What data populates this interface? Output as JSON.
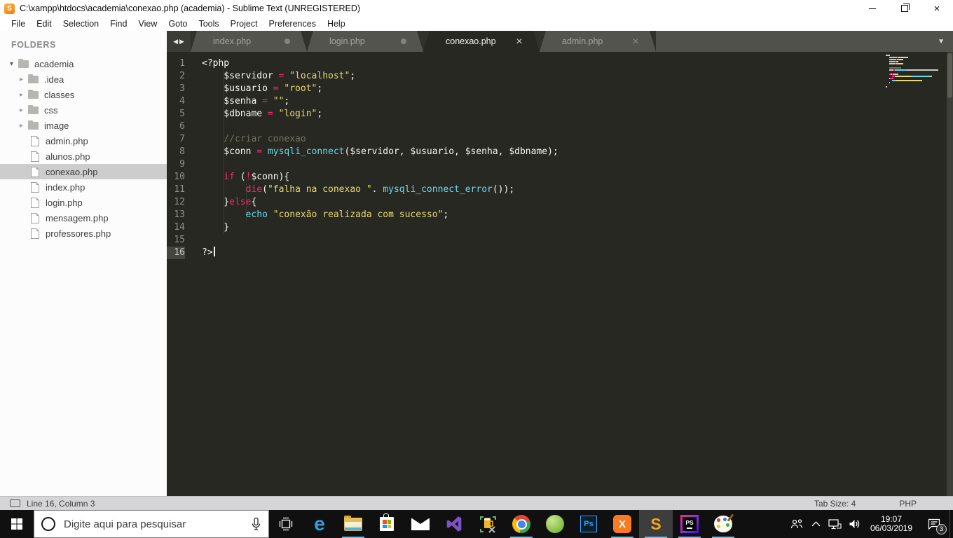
{
  "window": {
    "title": "C:\\xampp\\htdocs\\academia\\conexao.php (academia) - Sublime Text (UNREGISTERED)"
  },
  "menubar": {
    "items": [
      "File",
      "Edit",
      "Selection",
      "Find",
      "View",
      "Goto",
      "Tools",
      "Project",
      "Preferences",
      "Help"
    ]
  },
  "sidebar": {
    "header": "FOLDERS",
    "tree": [
      {
        "label": "academia",
        "type": "folder",
        "depth": 0,
        "expanded": true
      },
      {
        "label": ".idea",
        "type": "folder",
        "depth": 1,
        "expanded": false
      },
      {
        "label": "classes",
        "type": "folder",
        "depth": 1,
        "expanded": false
      },
      {
        "label": "css",
        "type": "folder",
        "depth": 1,
        "expanded": false
      },
      {
        "label": "image",
        "type": "folder",
        "depth": 1,
        "expanded": false
      },
      {
        "label": "admin.php",
        "type": "file",
        "depth": 1
      },
      {
        "label": "alunos.php",
        "type": "file",
        "depth": 1
      },
      {
        "label": "conexao.php",
        "type": "file",
        "depth": 1,
        "selected": true
      },
      {
        "label": "index.php",
        "type": "file",
        "depth": 1
      },
      {
        "label": "login.php",
        "type": "file",
        "depth": 1
      },
      {
        "label": "mensagem.php",
        "type": "file",
        "depth": 1
      },
      {
        "label": "professores.php",
        "type": "file",
        "depth": 1
      }
    ]
  },
  "tabbar": {
    "tabs": [
      {
        "label": "index.php",
        "modified": true,
        "active": false
      },
      {
        "label": "login.php",
        "modified": true,
        "active": false
      },
      {
        "label": "conexao.php",
        "modified": false,
        "active": true
      },
      {
        "label": "admin.php",
        "modified": false,
        "active": false
      }
    ]
  },
  "icons": {
    "tab_scroll_left": "◀",
    "tab_scroll_right": "▶",
    "tab_overflow": "▼",
    "tree_collapsed": "▸",
    "tree_expanded": "▾",
    "close": "✕"
  },
  "editor": {
    "lines": [
      {
        "n": 1,
        "segs": [
          [
            "w",
            "<?php"
          ]
        ]
      },
      {
        "n": 2,
        "segs": [
          [
            "w",
            "    $servidor "
          ],
          [
            "p",
            "="
          ],
          [
            "w",
            " "
          ],
          [
            "y",
            "\"localhost\""
          ],
          [
            "w",
            ";"
          ]
        ]
      },
      {
        "n": 3,
        "segs": [
          [
            "w",
            "    $usuario "
          ],
          [
            "p",
            "="
          ],
          [
            "w",
            " "
          ],
          [
            "y",
            "\"root\""
          ],
          [
            "w",
            ";"
          ]
        ]
      },
      {
        "n": 4,
        "segs": [
          [
            "w",
            "    $senha "
          ],
          [
            "p",
            "="
          ],
          [
            "w",
            " "
          ],
          [
            "y",
            "\"\""
          ],
          [
            "w",
            ";"
          ]
        ]
      },
      {
        "n": 5,
        "segs": [
          [
            "w",
            "    $dbname "
          ],
          [
            "p",
            "="
          ],
          [
            "w",
            " "
          ],
          [
            "y",
            "\"login\""
          ],
          [
            "w",
            ";"
          ]
        ]
      },
      {
        "n": 6,
        "segs": []
      },
      {
        "n": 7,
        "segs": [
          [
            "g",
            "    //criar conexao"
          ]
        ]
      },
      {
        "n": 8,
        "segs": [
          [
            "w",
            "    $conn "
          ],
          [
            "p",
            "="
          ],
          [
            "w",
            " "
          ],
          [
            "c",
            "mysqli_connect"
          ],
          [
            "w",
            "($servidor, $usuario, $senha, $dbname);"
          ]
        ]
      },
      {
        "n": 9,
        "segs": []
      },
      {
        "n": 10,
        "segs": [
          [
            "w",
            "    "
          ],
          [
            "p",
            "if"
          ],
          [
            "w",
            " ("
          ],
          [
            "p",
            "!"
          ],
          [
            "w",
            "$conn){"
          ]
        ]
      },
      {
        "n": 11,
        "segs": [
          [
            "w",
            "        "
          ],
          [
            "p",
            "die"
          ],
          [
            "w",
            "("
          ],
          [
            "y",
            "\"falha na conexao \""
          ],
          [
            "w",
            ". "
          ],
          [
            "c",
            "mysqli_connect_error"
          ],
          [
            "w",
            "());"
          ]
        ]
      },
      {
        "n": 12,
        "segs": [
          [
            "w",
            "    }"
          ],
          [
            "p",
            "else"
          ],
          [
            "w",
            "{"
          ]
        ]
      },
      {
        "n": 13,
        "segs": [
          [
            "w",
            "        "
          ],
          [
            "c",
            "echo"
          ],
          [
            "w",
            " "
          ],
          [
            "y",
            "\"conexão realizada com sucesso\""
          ],
          [
            "w",
            ";"
          ]
        ]
      },
      {
        "n": 14,
        "segs": [
          [
            "w",
            "    }"
          ]
        ]
      },
      {
        "n": 15,
        "segs": []
      },
      {
        "n": 16,
        "segs": [
          [
            "w",
            "?>"
          ]
        ],
        "cursor": true,
        "current": true
      }
    ]
  },
  "statusbar": {
    "position": "Line 16, Column 3",
    "tab_size": "Tab Size: 4",
    "syntax": "PHP"
  },
  "taskbar": {
    "search_placeholder": "Digite aqui para pesquisar",
    "apps": [
      {
        "name": "edge",
        "underline": false,
        "focused": false
      },
      {
        "name": "file-explorer",
        "underline": true,
        "focused": false
      },
      {
        "name": "microsoft-store",
        "underline": false,
        "focused": false
      },
      {
        "name": "mail",
        "underline": false,
        "focused": false
      },
      {
        "name": "visual-studio",
        "underline": false,
        "focused": false
      },
      {
        "name": "beer-tools",
        "underline": false,
        "focused": false
      },
      {
        "name": "chrome",
        "underline": true,
        "focused": false
      },
      {
        "name": "android-studio",
        "underline": false,
        "focused": false
      },
      {
        "name": "photoshop",
        "underline": false,
        "focused": false
      },
      {
        "name": "xampp",
        "underline": true,
        "focused": false
      },
      {
        "name": "sublime-text",
        "underline": true,
        "focused": true
      },
      {
        "name": "phpstorm",
        "underline": true,
        "focused": false
      },
      {
        "name": "paint",
        "underline": true,
        "focused": false
      }
    ],
    "tray": {
      "time": "19:07",
      "date": "06/03/2019",
      "notification_count": "3"
    }
  },
  "colors": {
    "editor_background": "#272822",
    "syntax_default": "#f8f8f2",
    "syntax_keyword_pink": "#f92672",
    "syntax_string_yellow": "#e6db74",
    "syntax_function_cyan": "#66d9ef",
    "syntax_comment_gray": "#75715e",
    "taskbar_underline_blue": "#76b9ed",
    "sidebar_selection_gray": "#cdcdcd",
    "xampp_orange": "#fb7a24",
    "sublime_orange": "#f7a41d"
  }
}
